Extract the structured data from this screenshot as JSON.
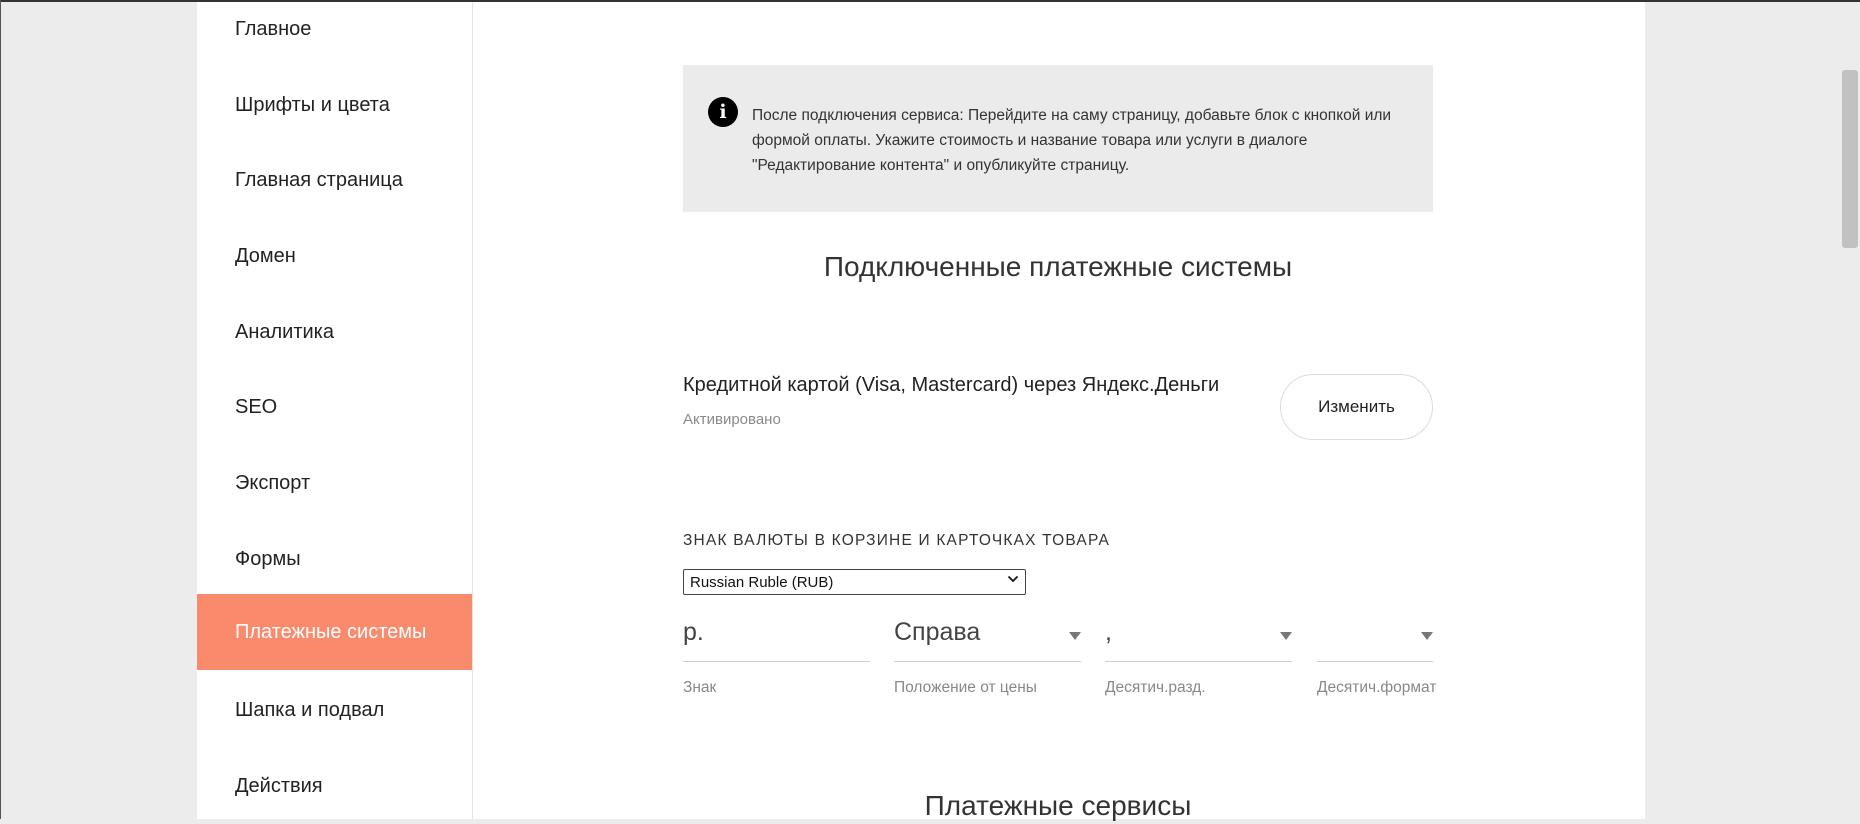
{
  "sidebar": {
    "items": [
      {
        "label": "Главное"
      },
      {
        "label": "Шрифты и цвета"
      },
      {
        "label": "Главная страница"
      },
      {
        "label": "Домен"
      },
      {
        "label": "Аналитика"
      },
      {
        "label": "SEO"
      },
      {
        "label": "Экспорт"
      },
      {
        "label": "Формы"
      },
      {
        "label": "Платежные системы",
        "active": true
      },
      {
        "label": "Шапка и подвал"
      },
      {
        "label": "Действия"
      }
    ]
  },
  "info": {
    "icon": "info-icon",
    "glyph": "i",
    "text": "После подключения сервиса: Перейдите на саму страницу, добавьте блок с кнопкой или формой оплаты. Укажите стоимость и название товара или услуги в диалоге \"Редактирование контента\" и опубликуйте страницу."
  },
  "connected": {
    "title": "Подключенные платежные системы",
    "system_name": "Кредитной картой (Visa, Mastercard) через Яндекс.Деньги",
    "status": "Активировано",
    "edit_label": "Изменить"
  },
  "currency": {
    "label": "ЗНАК ВАЛЮТЫ В КОРЗИНЕ И КАРТОЧКАХ ТОВАРА",
    "selected": "Russian Ruble (RUB)",
    "sign": {
      "value": "р.",
      "label": "Знак"
    },
    "position": {
      "value": "Справа",
      "label": "Положение от цены"
    },
    "decimal_sep": {
      "value": ",",
      "label": "Десятич.разд."
    },
    "decimal_format": {
      "value": "",
      "label": "Десятич.формат"
    }
  },
  "services": {
    "title": "Платежные сервисы"
  },
  "colors": {
    "accent": "#f98a6c",
    "page_bg": "#ececec",
    "info_bg": "#ebebeb"
  }
}
